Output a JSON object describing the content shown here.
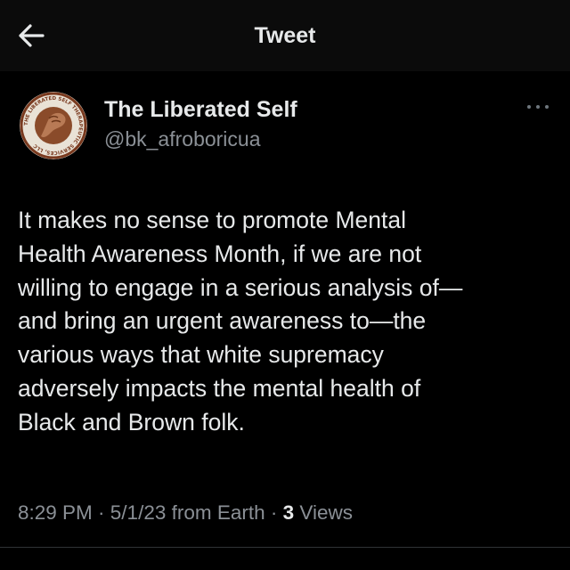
{
  "header": {
    "title": "Tweet",
    "back_icon": "arrow-left-icon"
  },
  "author": {
    "display_name": "The Liberated Self",
    "handle": "@bk_afroboricua",
    "avatar_ring_text": "THE LIBERATED SELF THERAPEUTIC SERVICES, LLC"
  },
  "more_icon": "more-horizontal-icon",
  "tweet": {
    "text": "It makes no sense to promote Mental\nHealth Awareness Month, if we are not\nwilling to engage in a serious analysis of—\nand bring an urgent awareness to—the\nvarious ways that white supremacy\nadversely impacts the mental health of\nBlack and Brown folk."
  },
  "meta": {
    "time": "8:29 PM",
    "sep1": " · ",
    "date": "5/1/23",
    "source": " from Earth",
    "sep2": " · ",
    "views_count": "3",
    "views_label": " Views"
  },
  "colors": {
    "background": "#000000",
    "header_bg": "#0b0b0b",
    "text": "#e7e9ea",
    "muted": "#8b9096"
  }
}
